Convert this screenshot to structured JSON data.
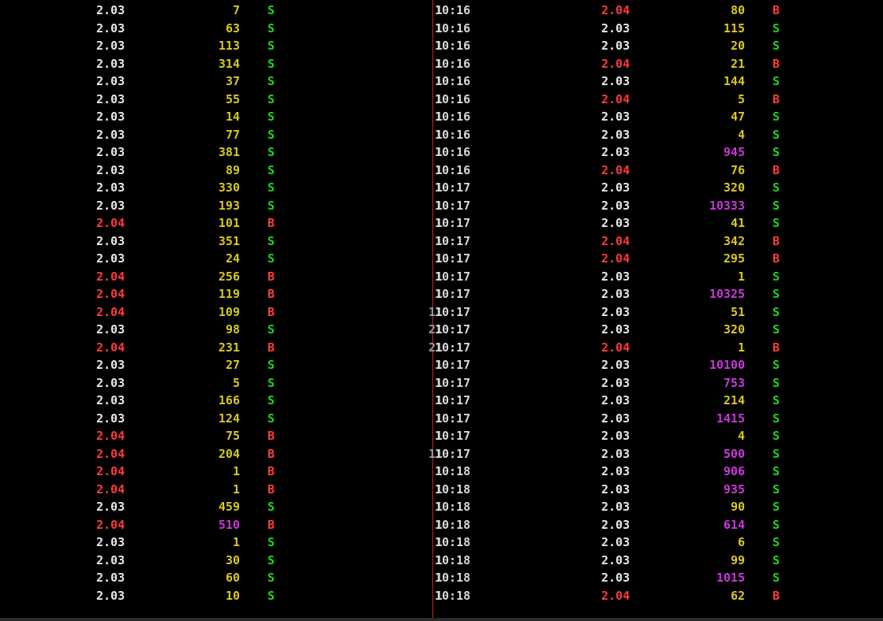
{
  "colors": {
    "background": "#000000",
    "price_up": "#ff3b3b",
    "price_flat": "#e8e8e8",
    "volume_normal": "#d8c824",
    "volume_large": "#c839d8",
    "buy": "#ff3b3b",
    "sell": "#1fd61f",
    "divider": "#c0282a"
  },
  "left_ticks": [
    {
      "price": "2.03",
      "volume": "7",
      "side": "S"
    },
    {
      "price": "2.03",
      "volume": "63",
      "side": "S"
    },
    {
      "price": "2.03",
      "volume": "113",
      "side": "S"
    },
    {
      "price": "2.03",
      "volume": "314",
      "side": "S"
    },
    {
      "price": "2.03",
      "volume": "37",
      "side": "S"
    },
    {
      "price": "2.03",
      "volume": "55",
      "side": "S"
    },
    {
      "price": "2.03",
      "volume": "14",
      "side": "S"
    },
    {
      "price": "2.03",
      "volume": "77",
      "side": "S"
    },
    {
      "price": "2.03",
      "volume": "381",
      "side": "S"
    },
    {
      "price": "2.03",
      "volume": "89",
      "side": "S"
    },
    {
      "price": "2.03",
      "volume": "330",
      "side": "S"
    },
    {
      "price": "2.03",
      "volume": "193",
      "side": "S"
    },
    {
      "price": "2.04",
      "volume": "101",
      "side": "B"
    },
    {
      "price": "2.03",
      "volume": "351",
      "side": "S"
    },
    {
      "price": "2.03",
      "volume": "24",
      "side": "S"
    },
    {
      "price": "2.04",
      "volume": "256",
      "side": "B"
    },
    {
      "price": "2.04",
      "volume": "119",
      "side": "B"
    },
    {
      "price": "2.04",
      "volume": "109",
      "side": "B"
    },
    {
      "price": "2.03",
      "volume": "98",
      "side": "S"
    },
    {
      "price": "2.04",
      "volume": "231",
      "side": "B"
    },
    {
      "price": "2.03",
      "volume": "27",
      "side": "S"
    },
    {
      "price": "2.03",
      "volume": "5",
      "side": "S"
    },
    {
      "price": "2.03",
      "volume": "166",
      "side": "S"
    },
    {
      "price": "2.03",
      "volume": "124",
      "side": "S"
    },
    {
      "price": "2.04",
      "volume": "75",
      "side": "B"
    },
    {
      "price": "2.04",
      "volume": "204",
      "side": "B"
    },
    {
      "price": "2.04",
      "volume": "1",
      "side": "B"
    },
    {
      "price": "2.04",
      "volume": "1",
      "side": "B"
    },
    {
      "price": "2.03",
      "volume": "459",
      "side": "S"
    },
    {
      "price": "2.04",
      "volume": "510",
      "side": "B",
      "large": true
    },
    {
      "price": "2.03",
      "volume": "1",
      "side": "S"
    },
    {
      "price": "2.03",
      "volume": "30",
      "side": "S"
    },
    {
      "price": "2.03",
      "volume": "60",
      "side": "S"
    },
    {
      "price": "2.03",
      "volume": "10",
      "side": "S"
    }
  ],
  "right_ticks": [
    {
      "time_prefix": "1",
      "time": "10:16",
      "price": "2.04",
      "volume": "80",
      "side": "B"
    },
    {
      "time_prefix": "1",
      "time": "10:16",
      "price": "2.03",
      "volume": "115",
      "side": "S"
    },
    {
      "time_prefix": "1",
      "time": "10:16",
      "price": "2.03",
      "volume": "20",
      "side": "S"
    },
    {
      "time_prefix": "1",
      "time": "10:16",
      "price": "2.04",
      "volume": "21",
      "side": "B"
    },
    {
      "time_prefix": "1",
      "time": "10:16",
      "price": "2.03",
      "volume": "144",
      "side": "S"
    },
    {
      "time_prefix": "1",
      "time": "10:16",
      "price": "2.04",
      "volume": "5",
      "side": "B"
    },
    {
      "time_prefix": "1",
      "time": "10:16",
      "price": "2.03",
      "volume": "47",
      "side": "S"
    },
    {
      "time_prefix": "1",
      "time": "10:16",
      "price": "2.03",
      "volume": "4",
      "side": "S"
    },
    {
      "time_prefix": "1",
      "time": "10:16",
      "price": "2.03",
      "volume": "945",
      "side": "S",
      "large": true
    },
    {
      "time_prefix": "1",
      "time": "10:16",
      "price": "2.04",
      "volume": "76",
      "side": "B"
    },
    {
      "time_prefix": "1",
      "time": "10:17",
      "price": "2.03",
      "volume": "320",
      "side": "S"
    },
    {
      "time_prefix": "1",
      "time": "10:17",
      "price": "2.03",
      "volume": "10333",
      "side": "S",
      "large": true
    },
    {
      "time_prefix": "1",
      "time": "10:17",
      "price": "2.03",
      "volume": "41",
      "side": "S"
    },
    {
      "time_prefix": "1",
      "time": "10:17",
      "price": "2.04",
      "volume": "342",
      "side": "B"
    },
    {
      "time_prefix": "1",
      "time": "10:17",
      "price": "2.04",
      "volume": "295",
      "side": "B"
    },
    {
      "time_prefix": "1",
      "time": "10:17",
      "price": "2.03",
      "volume": "1",
      "side": "S"
    },
    {
      "time_prefix": "1",
      "time": "10:17",
      "price": "2.03",
      "volume": "10325",
      "side": "S",
      "large": true
    },
    {
      "time_prefix": "11",
      "time": "10:17",
      "price": "2.03",
      "volume": "51",
      "side": "S"
    },
    {
      "time_prefix": "21",
      "time": "10:17",
      "price": "2.03",
      "volume": "320",
      "side": "S"
    },
    {
      "time_prefix": "21",
      "time": "10:17",
      "price": "2.04",
      "volume": "1",
      "side": "B"
    },
    {
      "time_prefix": "1",
      "time": "10:17",
      "price": "2.03",
      "volume": "10100",
      "side": "S",
      "large": true
    },
    {
      "time_prefix": "1",
      "time": "10:17",
      "price": "2.03",
      "volume": "753",
      "side": "S",
      "large": true
    },
    {
      "time_prefix": "1",
      "time": "10:17",
      "price": "2.03",
      "volume": "214",
      "side": "S"
    },
    {
      "time_prefix": "1",
      "time": "10:17",
      "price": "2.03",
      "volume": "1415",
      "side": "S",
      "large": true
    },
    {
      "time_prefix": "1",
      "time": "10:17",
      "price": "2.03",
      "volume": "4",
      "side": "S"
    },
    {
      "time_prefix": "11",
      "time": "10:17",
      "price": "2.03",
      "volume": "500",
      "side": "S",
      "large": true
    },
    {
      "time_prefix": "1",
      "time": "10:18",
      "price": "2.03",
      "volume": "906",
      "side": "S",
      "large": true
    },
    {
      "time_prefix": "1",
      "time": "10:18",
      "price": "2.03",
      "volume": "935",
      "side": "S",
      "large": true
    },
    {
      "time_prefix": "1",
      "time": "10:18",
      "price": "2.03",
      "volume": "90",
      "side": "S"
    },
    {
      "time_prefix": "1",
      "time": "10:18",
      "price": "2.03",
      "volume": "614",
      "side": "S",
      "large": true
    },
    {
      "time_prefix": "1",
      "time": "10:18",
      "price": "2.03",
      "volume": "6",
      "side": "S"
    },
    {
      "time_prefix": "1",
      "time": "10:18",
      "price": "2.03",
      "volume": "99",
      "side": "S"
    },
    {
      "time_prefix": "1",
      "time": "10:18",
      "price": "2.03",
      "volume": "1015",
      "side": "S",
      "large": true
    },
    {
      "time_prefix": "1",
      "time": "10:18",
      "price": "2.04",
      "volume": "62",
      "side": "B"
    }
  ]
}
